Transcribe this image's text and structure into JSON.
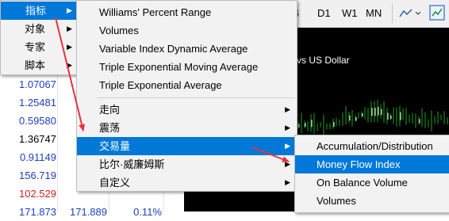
{
  "main_menu": {
    "items": [
      {
        "label": "指标",
        "has_submenu": true,
        "selected": true
      },
      {
        "label": "对象",
        "has_submenu": true
      },
      {
        "label": "专家",
        "has_submenu": true
      },
      {
        "label": "脚本",
        "has_submenu": true
      }
    ]
  },
  "indicator_menu": {
    "recent": [
      "Williams' Percent Range",
      "Volumes",
      "Variable Index Dynamic Average",
      "Triple Exponential Moving Average",
      "Triple Exponential Average"
    ],
    "categories": [
      {
        "label": "走向",
        "has_submenu": true
      },
      {
        "label": "震荡",
        "has_submenu": true
      },
      {
        "label": "交易量",
        "has_submenu": true,
        "selected": true
      },
      {
        "label": "比尔·威廉姆斯",
        "has_submenu": true
      },
      {
        "label": "自定义",
        "has_submenu": true
      }
    ]
  },
  "volume_menu": {
    "items": [
      {
        "label": "Accumulation/Distribution"
      },
      {
        "label": "Money Flow Index",
        "selected": true
      },
      {
        "label": "On Balance Volume"
      },
      {
        "label": "Volumes"
      }
    ]
  },
  "toolbar": {
    "timeframes": [
      "4",
      "D1",
      "W1",
      "MN"
    ]
  },
  "chart": {
    "title": "vs US Dollar"
  },
  "market_watch": {
    "rows": [
      {
        "bid": "1.07067",
        "ask": "",
        "change": "",
        "color": "#1c3fbf"
      },
      {
        "bid": "1.25481",
        "ask": "",
        "change": "",
        "color": "#1c3fbf"
      },
      {
        "bid": "0.59580",
        "ask": "",
        "change": "",
        "color": "#1c3fbf"
      },
      {
        "bid": "1.36747",
        "ask": "",
        "change": "",
        "color": "#000000"
      },
      {
        "bid": "0.91149",
        "ask": "",
        "change": "",
        "color": "#1c3fbf"
      },
      {
        "bid": "156.719",
        "ask": "",
        "change": "",
        "color": "#1c3fbf"
      },
      {
        "bid": "102.529",
        "ask": "",
        "change": "",
        "color": "#d0201b"
      },
      {
        "bid": "171.873",
        "ask": "171.889",
        "change": "0.11%",
        "color": "#1c3fbf"
      }
    ]
  },
  "colors": {
    "selection": "#0078d7",
    "arrow": "#e8323c",
    "chart_bg": "#000000",
    "candles": "#1aa31a"
  }
}
